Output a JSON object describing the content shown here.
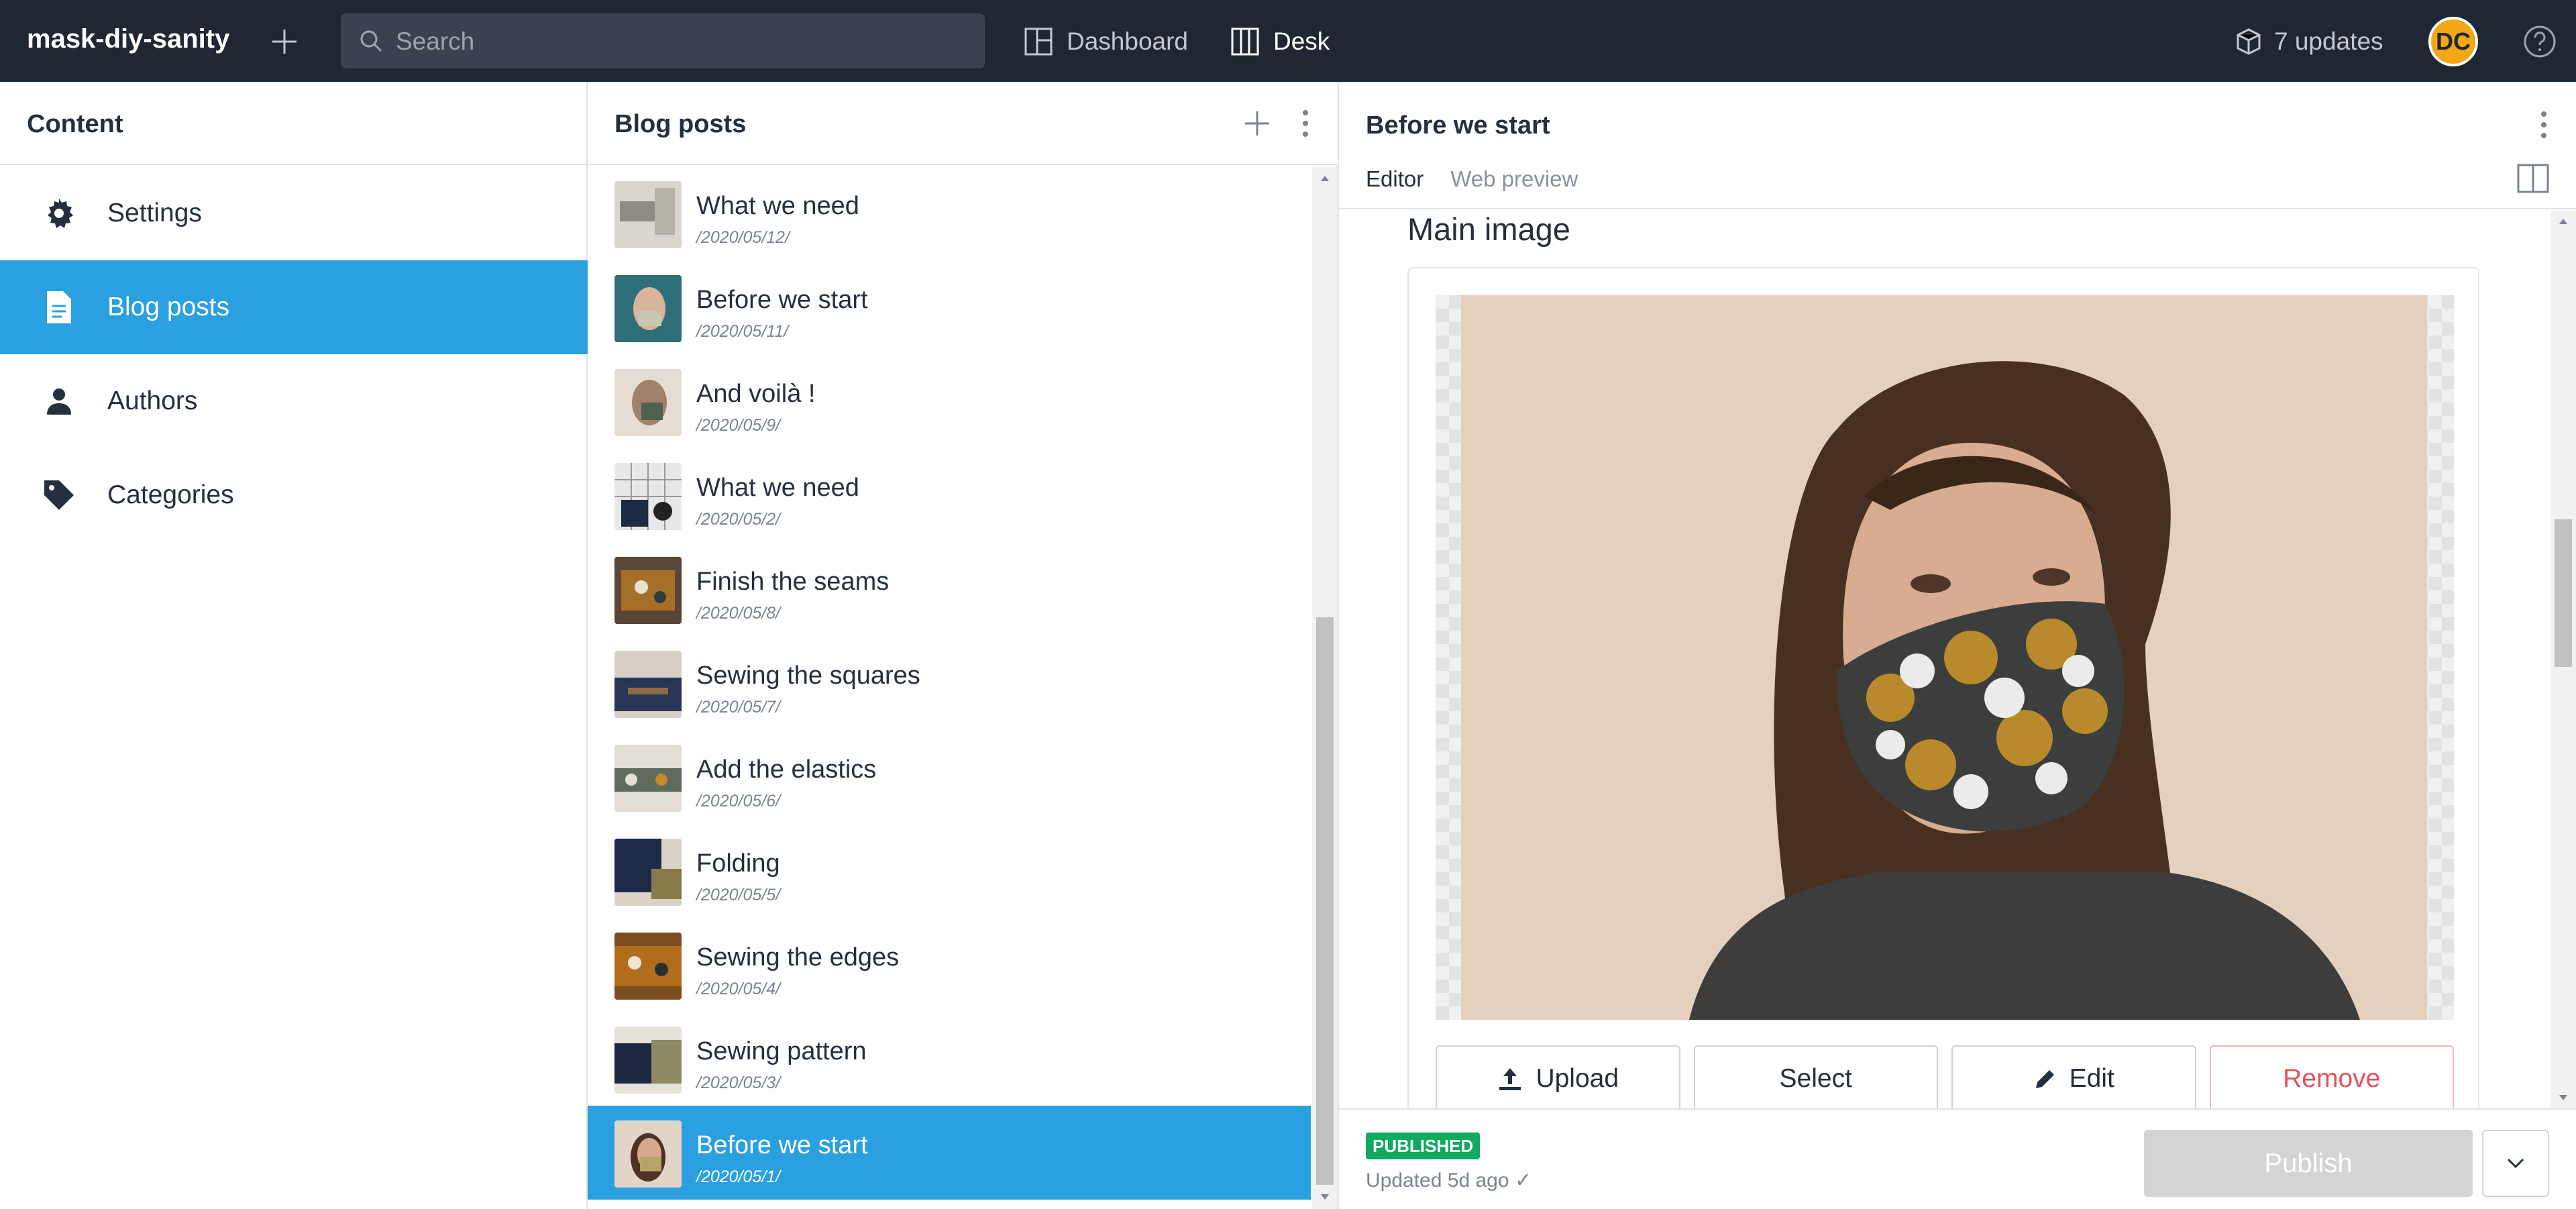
{
  "navbar": {
    "brand": "mask-diy-sanity",
    "search_placeholder": "Search",
    "tools": [
      {
        "label": "Dashboard",
        "icon": "dashboard-icon"
      },
      {
        "label": "Desk",
        "icon": "desk-icon"
      }
    ],
    "updates_label": "7 updates",
    "avatar_initials": "DC"
  },
  "content_pane": {
    "title": "Content",
    "items": [
      {
        "label": "Settings",
        "icon": "gear-icon"
      },
      {
        "label": "Blog posts",
        "icon": "document-icon",
        "selected": true
      },
      {
        "label": "Authors",
        "icon": "person-icon"
      },
      {
        "label": "Categories",
        "icon": "tag-icon"
      }
    ]
  },
  "posts_pane": {
    "title": "Blog posts",
    "posts": [
      {
        "title": "What we need",
        "slug": "/2020/05/12/"
      },
      {
        "title": "Before we start",
        "slug": "/2020/05/11/"
      },
      {
        "title": "And voilà !",
        "slug": "/2020/05/9/"
      },
      {
        "title": "What we need",
        "slug": "/2020/05/2/"
      },
      {
        "title": "Finish the seams",
        "slug": "/2020/05/8/"
      },
      {
        "title": "Sewing the squares",
        "slug": "/2020/05/7/"
      },
      {
        "title": "Add the elastics",
        "slug": "/2020/05/6/"
      },
      {
        "title": "Folding",
        "slug": "/2020/05/5/"
      },
      {
        "title": "Sewing the edges",
        "slug": "/2020/05/4/"
      },
      {
        "title": "Sewing pattern",
        "slug": "/2020/05/3/"
      },
      {
        "title": "Before we start",
        "slug": "/2020/05/1/",
        "selected": true
      }
    ]
  },
  "document_pane": {
    "title": "Before we start",
    "tabs": [
      {
        "label": "Editor",
        "active": true
      },
      {
        "label": "Web preview",
        "active": false
      }
    ],
    "field_label": "Main image",
    "image_buttons": {
      "upload": "Upload",
      "select": "Select",
      "edit": "Edit",
      "remove": "Remove"
    },
    "status_badge": "PUBLISHED",
    "updated_text": "Updated 5d ago ✓",
    "publish_label": "Publish"
  },
  "colors": {
    "navbar_bg": "#1f2733",
    "selected_bg": "#2aa0e0",
    "published_green": "#0fa960",
    "danger_red": "#e0525c"
  }
}
